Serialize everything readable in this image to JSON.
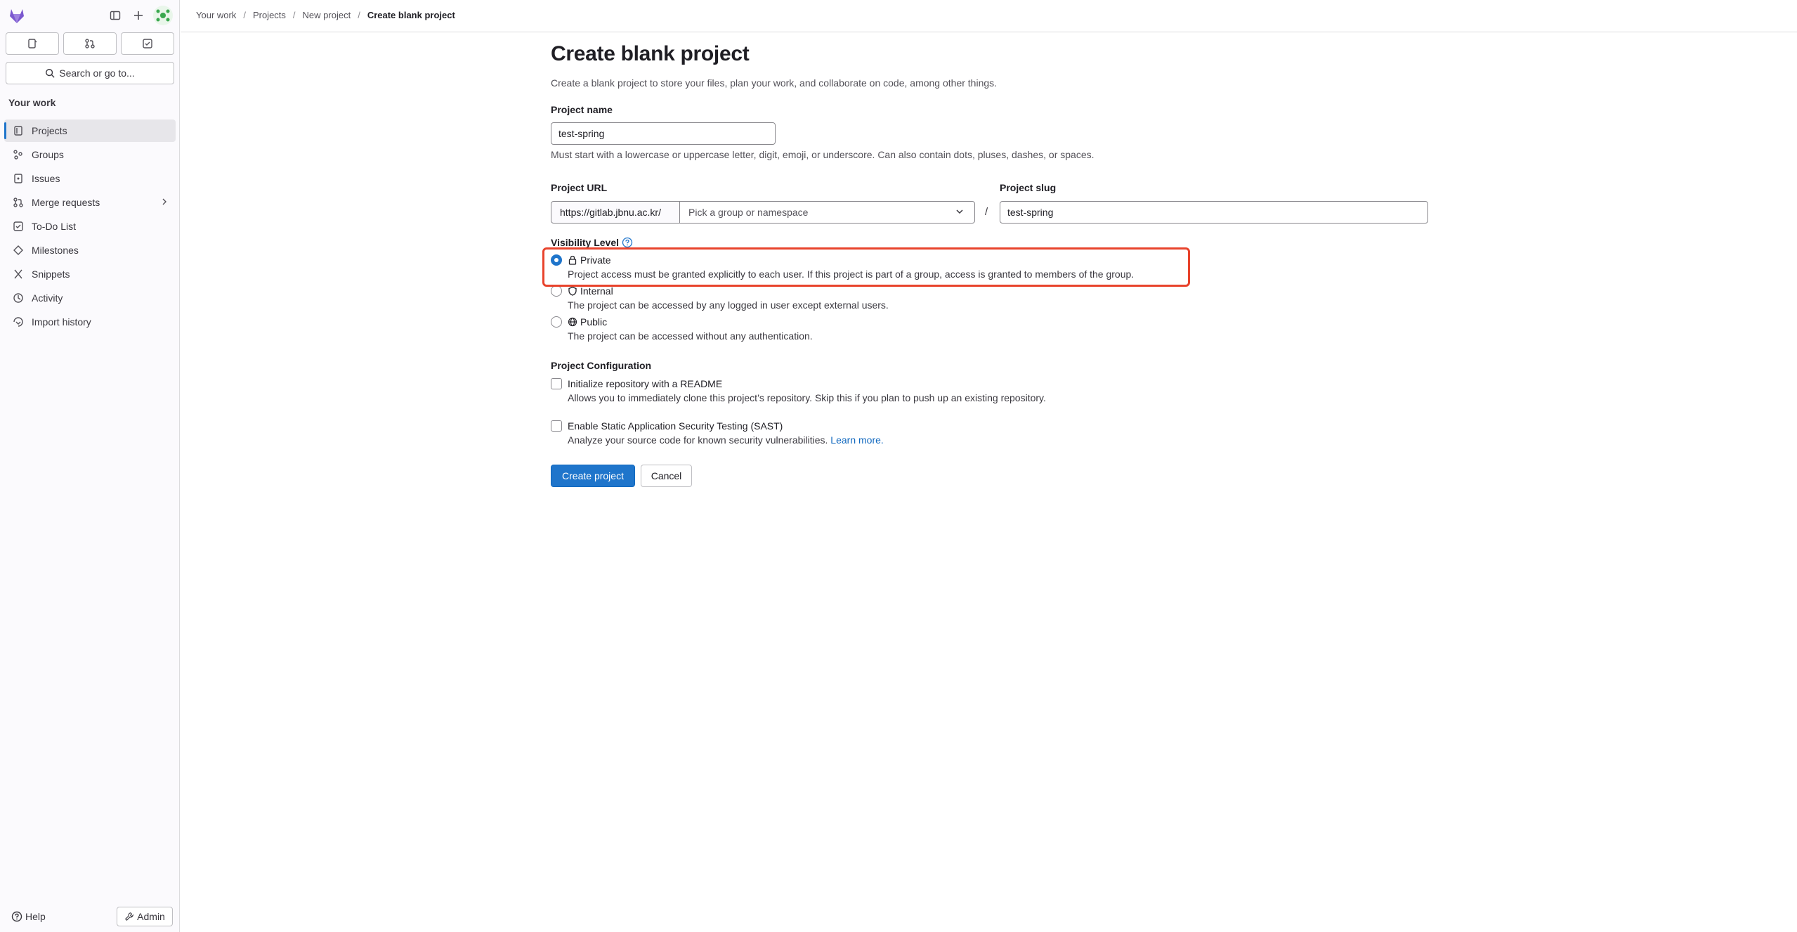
{
  "sidebar": {
    "counters": [
      "issues",
      "merge-requests",
      "todos"
    ],
    "search_label": "Search or go to...",
    "section_title": "Your work",
    "items": [
      {
        "label": "Projects",
        "icon": "project-icon"
      },
      {
        "label": "Groups",
        "icon": "group-icon"
      },
      {
        "label": "Issues",
        "icon": "issues-icon"
      },
      {
        "label": "Merge requests",
        "icon": "merge-request-icon"
      },
      {
        "label": "To-Do List",
        "icon": "todo-icon"
      },
      {
        "label": "Milestones",
        "icon": "milestone-icon"
      },
      {
        "label": "Snippets",
        "icon": "snippet-icon"
      },
      {
        "label": "Activity",
        "icon": "activity-icon"
      },
      {
        "label": "Import history",
        "icon": "import-icon"
      }
    ],
    "help_label": "Help",
    "admin_label": "Admin"
  },
  "breadcrumb": {
    "items": [
      "Your work",
      "Projects",
      "New project"
    ],
    "current": "Create blank project"
  },
  "main": {
    "title": "Create blank project",
    "description": "Create a blank project to store your files, plan your work, and collaborate on code, among other things.",
    "project_name": {
      "label": "Project name",
      "value": "test-spring",
      "help": "Must start with a lowercase or uppercase letter, digit, emoji, or underscore. Can also contain dots, pluses, dashes, or spaces."
    },
    "project_url": {
      "label": "Project URL",
      "prefix": "https://gitlab.jbnu.ac.kr/",
      "namespace_placeholder": "Pick a group or namespace"
    },
    "slash": "/",
    "project_slug": {
      "label": "Project slug",
      "value": "test-spring"
    },
    "visibility": {
      "label": "Visibility Level",
      "options": [
        {
          "label": "Private",
          "icon": "lock-icon",
          "desc": "Project access must be granted explicitly to each user. If this project is part of a group, access is granted to members of the group.",
          "checked": true
        },
        {
          "label": "Internal",
          "icon": "shield-icon",
          "desc": "The project can be accessed by any logged in user except external users.",
          "checked": false
        },
        {
          "label": "Public",
          "icon": "globe-icon",
          "desc": "The project can be accessed without any authentication.",
          "checked": false
        }
      ]
    },
    "configuration": {
      "label": "Project Configuration",
      "readme_label": "Initialize repository with a README",
      "readme_desc": "Allows you to immediately clone this project’s repository. Skip this if you plan to push up an existing repository.",
      "sast_label": "Enable Static Application Security Testing (SAST)",
      "sast_desc": "Analyze your source code for known security vulnerabilities.",
      "sast_link": "Learn more."
    },
    "buttons": {
      "create": "Create project",
      "cancel": "Cancel"
    }
  },
  "colors": {
    "primary": "#1f75cb",
    "highlight": "#e8432c",
    "logo": "#7b58cf"
  }
}
